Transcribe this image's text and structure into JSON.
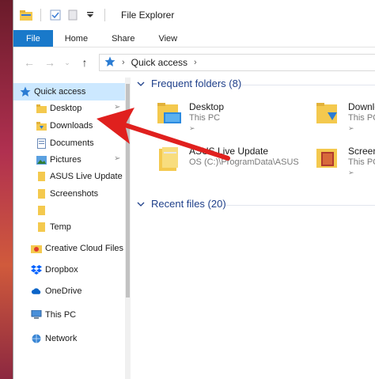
{
  "window": {
    "title": "File Explorer"
  },
  "ribbon": {
    "tabs": [
      "File",
      "Home",
      "Share",
      "View"
    ]
  },
  "address": {
    "location": "Quick access"
  },
  "sidebar": {
    "items": [
      {
        "label": "Quick access",
        "icon": "star-icon"
      },
      {
        "label": "Desktop",
        "icon": "folder-icon"
      },
      {
        "label": "Downloads",
        "icon": "download-folder-icon"
      },
      {
        "label": "Documents",
        "icon": "documents-icon"
      },
      {
        "label": "Pictures",
        "icon": "pictures-icon"
      },
      {
        "label": "ASUS Live Update",
        "icon": "folder-icon"
      },
      {
        "label": "Screenshots",
        "icon": "folder-icon"
      },
      {
        "label": "",
        "icon": "folder-icon"
      },
      {
        "label": "Temp",
        "icon": "folder-icon"
      },
      {
        "label": "Creative Cloud Files",
        "icon": "creative-cloud-icon"
      },
      {
        "label": "Dropbox",
        "icon": "dropbox-icon"
      },
      {
        "label": "OneDrive",
        "icon": "cloud-icon"
      },
      {
        "label": "This PC",
        "icon": "computer-icon"
      },
      {
        "label": "Network",
        "icon": "network-icon"
      }
    ]
  },
  "frequent": {
    "header": "Frequent folders (8)",
    "tiles": [
      {
        "name": "Desktop",
        "sub": "This PC"
      },
      {
        "name": "Downlo",
        "sub": "This PC"
      },
      {
        "name": "ASUS Live Update",
        "sub": "OS (C:)\\ProgramData\\ASUS"
      },
      {
        "name": "Screens",
        "sub": "This PC"
      }
    ]
  },
  "recent": {
    "header": "Recent files (20)"
  },
  "colors": {
    "accent": "#1979ca",
    "selection": "#cce8ff",
    "header_text": "#1e3f8a",
    "folder": "#f4c94e",
    "annotation": "#e0201e"
  }
}
